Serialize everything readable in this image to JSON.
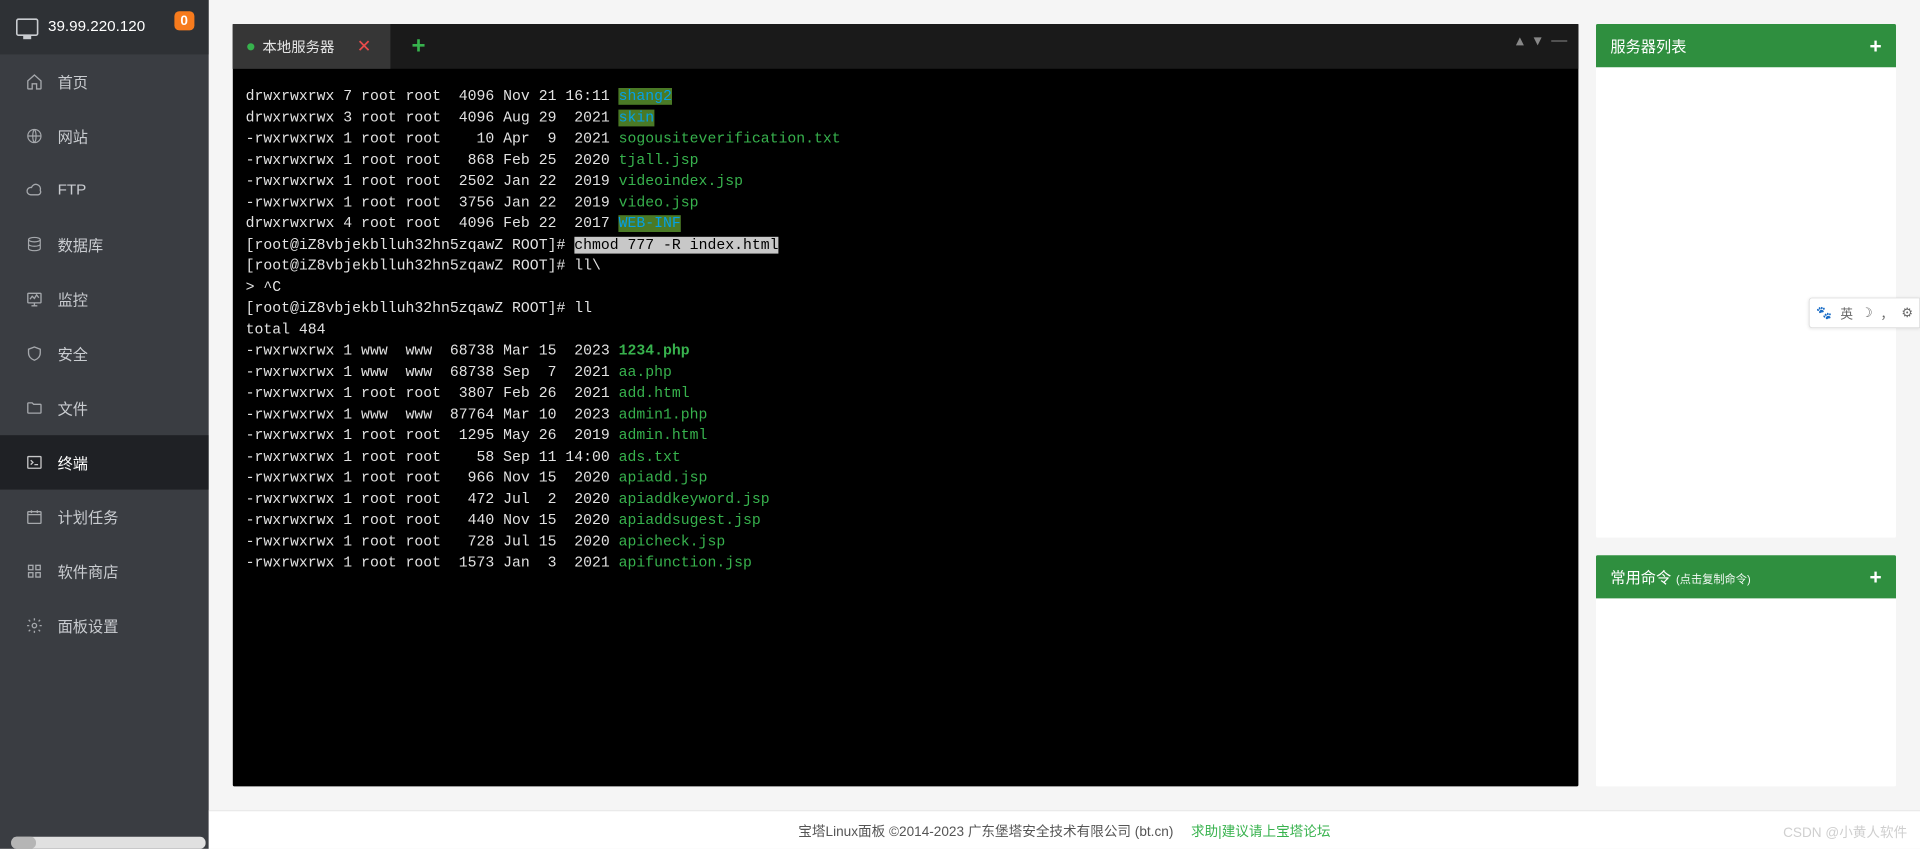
{
  "header": {
    "ip": "39.99.220.120",
    "notif_count": "0"
  },
  "sidebar": [
    {
      "id": "home",
      "label": "首页",
      "icon": "home"
    },
    {
      "id": "site",
      "label": "网站",
      "icon": "globe"
    },
    {
      "id": "ftp",
      "label": "FTP",
      "icon": "cloud"
    },
    {
      "id": "db",
      "label": "数据库",
      "icon": "db"
    },
    {
      "id": "monitor",
      "label": "监控",
      "icon": "monitor"
    },
    {
      "id": "security",
      "label": "安全",
      "icon": "shield"
    },
    {
      "id": "files",
      "label": "文件",
      "icon": "folder"
    },
    {
      "id": "terminal",
      "label": "终端",
      "icon": "terminal",
      "active": true
    },
    {
      "id": "cron",
      "label": "计划任务",
      "icon": "calendar"
    },
    {
      "id": "store",
      "label": "软件商店",
      "icon": "grid"
    },
    {
      "id": "panel",
      "label": "面板设置",
      "icon": "gear"
    }
  ],
  "tabs": {
    "active_label": "本地服务器"
  },
  "right": {
    "server_list_title": "服务器列表",
    "cmd_title": "常用命令",
    "cmd_sub": "(点击复制命令)"
  },
  "terminal": {
    "lines": [
      {
        "t": "ls",
        "perm": "drwxrwxrwx",
        "n": "7",
        "u": "root",
        "g": "root",
        "sz": "4096",
        "date": "Nov 21 16:11",
        "name": "shang2",
        "cls": "dir-hl"
      },
      {
        "t": "ls",
        "perm": "drwxrwxrwx",
        "n": "3",
        "u": "root",
        "g": "root",
        "sz": "4096",
        "date": "Aug 29  2021",
        "name": "skin",
        "cls": "dir-hl"
      },
      {
        "t": "ls",
        "perm": "-rwxrwxrwx",
        "n": "1",
        "u": "root",
        "g": "root",
        "sz": "10",
        "date": "Apr  9  2021",
        "name": "sogousiteverification.txt",
        "cls": "file"
      },
      {
        "t": "ls",
        "perm": "-rwxrwxrwx",
        "n": "1",
        "u": "root",
        "g": "root",
        "sz": "868",
        "date": "Feb 25  2020",
        "name": "tjall.jsp",
        "cls": "file"
      },
      {
        "t": "ls",
        "perm": "-rwxrwxrwx",
        "n": "1",
        "u": "root",
        "g": "root",
        "sz": "2502",
        "date": "Jan 22  2019",
        "name": "videoindex.jsp",
        "cls": "file"
      },
      {
        "t": "ls",
        "perm": "-rwxrwxrwx",
        "n": "1",
        "u": "root",
        "g": "root",
        "sz": "3756",
        "date": "Jan 22  2019",
        "name": "video.jsp",
        "cls": "file"
      },
      {
        "t": "ls",
        "perm": "drwxrwxrwx",
        "n": "4",
        "u": "root",
        "g": "root",
        "sz": "4096",
        "date": "Feb 22  2017",
        "name": "WEB-INF",
        "cls": "dir-hl"
      },
      {
        "t": "prompt",
        "text": "[root@iZ8vbjekblluh32hn5zqawZ ROOT]# ",
        "sel": "chmod 777 -R index.html"
      },
      {
        "t": "prompt",
        "text": "[root@iZ8vbjekblluh32hn5zqawZ ROOT]# ll\\"
      },
      {
        "t": "raw",
        "text": "> ^C"
      },
      {
        "t": "prompt",
        "text": "[root@iZ8vbjekblluh32hn5zqawZ ROOT]# ll"
      },
      {
        "t": "raw",
        "text": "total 484"
      },
      {
        "t": "ls",
        "perm": "-rwxrwxrwx",
        "n": "1",
        "u": "www ",
        "g": "www ",
        "sz": "68738",
        "date": "Mar 15  2023",
        "name": "1234.php",
        "cls": "file-b"
      },
      {
        "t": "ls",
        "perm": "-rwxrwxrwx",
        "n": "1",
        "u": "www ",
        "g": "www ",
        "sz": "68738",
        "date": "Sep  7  2021",
        "name": "aa.php",
        "cls": "file"
      },
      {
        "t": "ls",
        "perm": "-rwxrwxrwx",
        "n": "1",
        "u": "root",
        "g": "root",
        "sz": "3807",
        "date": "Feb 26  2021",
        "name": "add.html",
        "cls": "file"
      },
      {
        "t": "ls",
        "perm": "-rwxrwxrwx",
        "n": "1",
        "u": "www ",
        "g": "www ",
        "sz": "87764",
        "date": "Mar 10  2023",
        "name": "admin1.php",
        "cls": "file"
      },
      {
        "t": "ls",
        "perm": "-rwxrwxrwx",
        "n": "1",
        "u": "root",
        "g": "root",
        "sz": "1295",
        "date": "May 26  2019",
        "name": "admin.html",
        "cls": "file"
      },
      {
        "t": "ls",
        "perm": "-rwxrwxrwx",
        "n": "1",
        "u": "root",
        "g": "root",
        "sz": "58",
        "date": "Sep 11 14:00",
        "name": "ads.txt",
        "cls": "file"
      },
      {
        "t": "ls",
        "perm": "-rwxrwxrwx",
        "n": "1",
        "u": "root",
        "g": "root",
        "sz": "966",
        "date": "Nov 15  2020",
        "name": "apiadd.jsp",
        "cls": "file"
      },
      {
        "t": "ls",
        "perm": "-rwxrwxrwx",
        "n": "1",
        "u": "root",
        "g": "root",
        "sz": "472",
        "date": "Jul  2  2020",
        "name": "apiaddkeyword.jsp",
        "cls": "file"
      },
      {
        "t": "ls",
        "perm": "-rwxrwxrwx",
        "n": "1",
        "u": "root",
        "g": "root",
        "sz": "440",
        "date": "Nov 15  2020",
        "name": "apiaddsugest.jsp",
        "cls": "file"
      },
      {
        "t": "ls",
        "perm": "-rwxrwxrwx",
        "n": "1",
        "u": "root",
        "g": "root",
        "sz": "728",
        "date": "Jul 15  2020",
        "name": "apicheck.jsp",
        "cls": "file"
      },
      {
        "t": "ls",
        "perm": "-rwxrwxrwx",
        "n": "1",
        "u": "root",
        "g": "root",
        "sz": "1573",
        "date": "Jan  3  2021",
        "name": "apifunction.jsp",
        "cls": "file"
      }
    ]
  },
  "footer": {
    "copyright": "宝塔Linux面板 ©2014-2023 广东堡塔安全技术有限公司 (bt.cn)",
    "link_help": "求助",
    "link_sep": "|",
    "link_forum": "建议请上宝塔论坛"
  },
  "watermark": "CSDN @小黄人软件",
  "float_tool": {
    "lang": "英"
  }
}
